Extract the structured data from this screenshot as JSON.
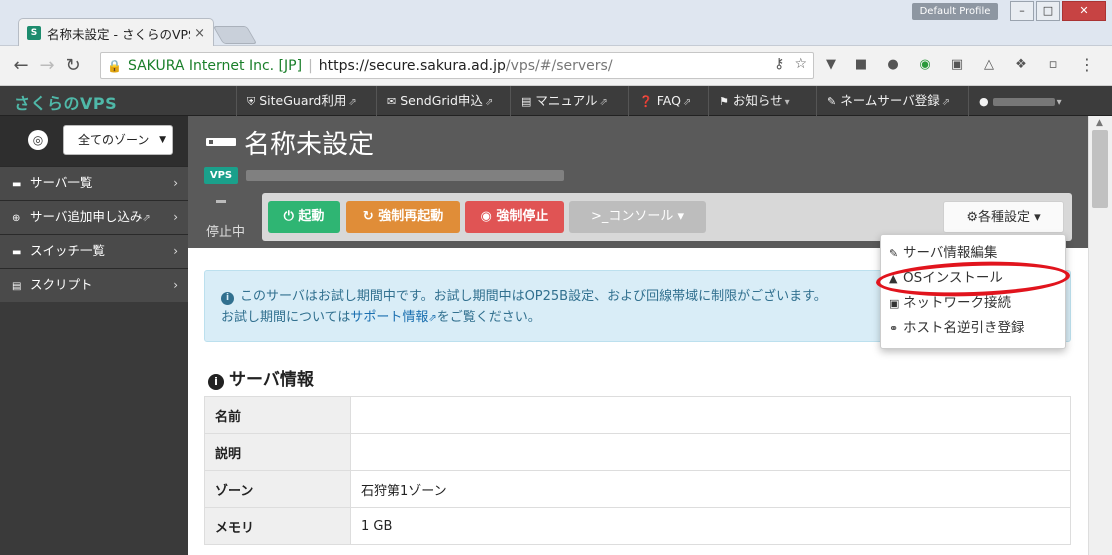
{
  "browser": {
    "tab_title": "名称未設定 - さくらのVPS",
    "tab_favicon": "favicon",
    "tab_close": "×",
    "profile": "Default Profile",
    "win_min": "–",
    "win_max": "□",
    "win_close": "✕",
    "back": "←",
    "forward": "→",
    "reload": "↻",
    "secure_label": "SAKURA Internet Inc. [JP]",
    "url_host": "https://secure.sakura.ad.jp",
    "url_path": "/vps/#/servers/",
    "key_icon": "⚷",
    "star_icon": "☆",
    "menu_icon": "⋮"
  },
  "site": {
    "logo": "さくらのVPS",
    "nav": [
      {
        "label": "SiteGuard利用"
      },
      {
        "label": "SendGrid申込"
      },
      {
        "label": "マニュアル"
      },
      {
        "label": "FAQ"
      },
      {
        "label": "お知らせ"
      },
      {
        "label": "ネームサーバ登録"
      }
    ],
    "ext_icon": "⇗",
    "caret": "▾"
  },
  "sidebar": {
    "zone": "全てのゾーン",
    "items": [
      {
        "label": "サーバ一覧"
      },
      {
        "label": "サーバ追加申し込み"
      },
      {
        "label": "スイッチ一覧"
      },
      {
        "label": "スクリプト"
      }
    ],
    "chevron": "›"
  },
  "server": {
    "title": "名称未設定",
    "badge": "VPS",
    "status": "停止中"
  },
  "actions": {
    "start": "起動",
    "restart": "強制再起動",
    "stop": "強制停止",
    "console": "コンソール",
    "settings": "各種設定"
  },
  "menu": [
    {
      "label": "サーバ情報編集"
    },
    {
      "label": "OSインストール"
    },
    {
      "label": "ネットワーク接続"
    },
    {
      "label": "ホスト名逆引き登録"
    }
  ],
  "notice": {
    "line1": "このサーバはお試し期間中です。お試し期間中はOP25B設定、および回線帯域に制限がございます。",
    "line2_pre": "お試し期間については",
    "link": "サポート情報",
    "line2_post": "をご覧ください。"
  },
  "section": {
    "title": "サーバ情報",
    "rows": [
      {
        "key": "名前",
        "value": ""
      },
      {
        "key": "説明",
        "value": ""
      },
      {
        "key": "ゾーン",
        "value": "石狩第1ゾーン"
      },
      {
        "key": "メモリ",
        "value": "1 GB"
      }
    ]
  },
  "colors": {
    "accent": "#1aa08b",
    "start": "#2fb573",
    "restart": "#e08d38",
    "stop": "#e05454",
    "highlight": "#e1141d"
  }
}
